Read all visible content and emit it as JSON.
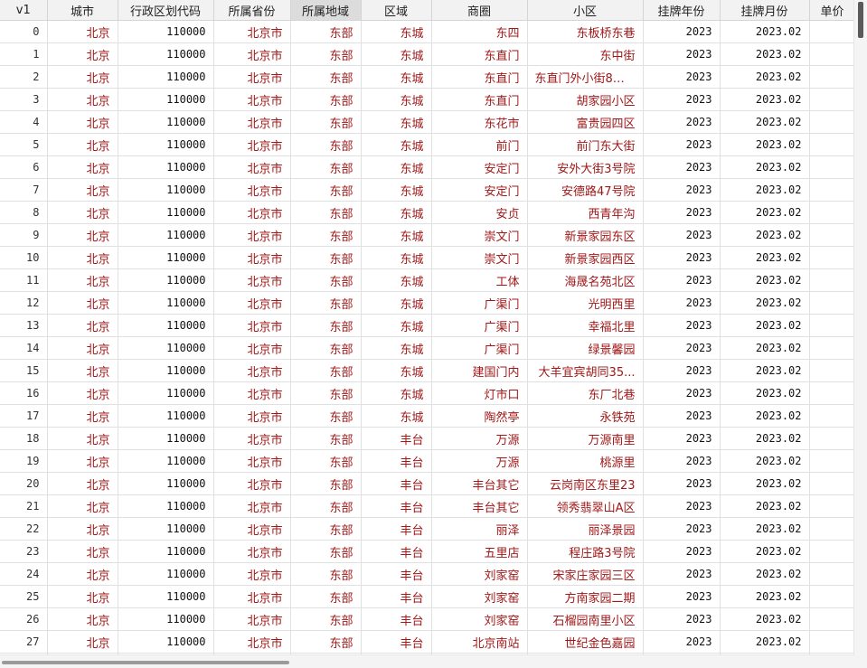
{
  "columns": [
    "v1",
    "城市",
    "行政区划代码",
    "所属省份",
    "所属地域",
    "区域",
    "商圈",
    "小区",
    "挂牌年份",
    "挂牌月份",
    "单价"
  ],
  "selected_column": "所属地域",
  "rows": [
    [
      "0",
      "北京",
      "110000",
      "北京市",
      "东部",
      "东城",
      "东四",
      "东板桥东巷",
      "2023",
      "2023.02",
      ""
    ],
    [
      "1",
      "北京",
      "110000",
      "北京市",
      "东部",
      "东城",
      "东直门",
      "东中街",
      "2023",
      "2023.02",
      ""
    ],
    [
      "2",
      "北京",
      "110000",
      "北京市",
      "东部",
      "东城",
      "东直门",
      "东直门外小街8号...",
      "2023",
      "2023.02",
      ""
    ],
    [
      "3",
      "北京",
      "110000",
      "北京市",
      "东部",
      "东城",
      "东直门",
      "胡家园小区",
      "2023",
      "2023.02",
      ""
    ],
    [
      "4",
      "北京",
      "110000",
      "北京市",
      "东部",
      "东城",
      "东花市",
      "富贵园四区",
      "2023",
      "2023.02",
      ""
    ],
    [
      "5",
      "北京",
      "110000",
      "北京市",
      "东部",
      "东城",
      "前门",
      "前门东大街",
      "2023",
      "2023.02",
      ""
    ],
    [
      "6",
      "北京",
      "110000",
      "北京市",
      "东部",
      "东城",
      "安定门",
      "安外大街3号院",
      "2023",
      "2023.02",
      ""
    ],
    [
      "7",
      "北京",
      "110000",
      "北京市",
      "东部",
      "东城",
      "安定门",
      "安德路47号院",
      "2023",
      "2023.02",
      ""
    ],
    [
      "8",
      "北京",
      "110000",
      "北京市",
      "东部",
      "东城",
      "安贞",
      "西青年沟",
      "2023",
      "2023.02",
      ""
    ],
    [
      "9",
      "北京",
      "110000",
      "北京市",
      "东部",
      "东城",
      "崇文门",
      "新景家园东区",
      "2023",
      "2023.02",
      ""
    ],
    [
      "10",
      "北京",
      "110000",
      "北京市",
      "东部",
      "东城",
      "崇文门",
      "新景家园西区",
      "2023",
      "2023.02",
      ""
    ],
    [
      "11",
      "北京",
      "110000",
      "北京市",
      "东部",
      "东城",
      "工体",
      "海晟名苑北区",
      "2023",
      "2023.02",
      ""
    ],
    [
      "12",
      "北京",
      "110000",
      "北京市",
      "东部",
      "东城",
      "广渠门",
      "光明西里",
      "2023",
      "2023.02",
      ""
    ],
    [
      "13",
      "北京",
      "110000",
      "北京市",
      "东部",
      "东城",
      "广渠门",
      "幸福北里",
      "2023",
      "2023.02",
      ""
    ],
    [
      "14",
      "北京",
      "110000",
      "北京市",
      "东部",
      "东城",
      "广渠门",
      "绿景馨园",
      "2023",
      "2023.02",
      ""
    ],
    [
      "15",
      "北京",
      "110000",
      "北京市",
      "东部",
      "东城",
      "建国门内",
      "大羊宜宾胡同35...",
      "2023",
      "2023.02",
      ""
    ],
    [
      "16",
      "北京",
      "110000",
      "北京市",
      "东部",
      "东城",
      "灯市口",
      "东厂北巷",
      "2023",
      "2023.02",
      ""
    ],
    [
      "17",
      "北京",
      "110000",
      "北京市",
      "东部",
      "东城",
      "陶然亭",
      "永铁苑",
      "2023",
      "2023.02",
      ""
    ],
    [
      "18",
      "北京",
      "110000",
      "北京市",
      "东部",
      "丰台",
      "万源",
      "万源南里",
      "2023",
      "2023.02",
      ""
    ],
    [
      "19",
      "北京",
      "110000",
      "北京市",
      "东部",
      "丰台",
      "万源",
      "桃源里",
      "2023",
      "2023.02",
      ""
    ],
    [
      "20",
      "北京",
      "110000",
      "北京市",
      "东部",
      "丰台",
      "丰台其它",
      "云岗南区东里23",
      "2023",
      "2023.02",
      ""
    ],
    [
      "21",
      "北京",
      "110000",
      "北京市",
      "东部",
      "丰台",
      "丰台其它",
      "领秀翡翠山A区",
      "2023",
      "2023.02",
      ""
    ],
    [
      "22",
      "北京",
      "110000",
      "北京市",
      "东部",
      "丰台",
      "丽泽",
      "丽泽景园",
      "2023",
      "2023.02",
      ""
    ],
    [
      "23",
      "北京",
      "110000",
      "北京市",
      "东部",
      "丰台",
      "五里店",
      "程庄路3号院",
      "2023",
      "2023.02",
      ""
    ],
    [
      "24",
      "北京",
      "110000",
      "北京市",
      "东部",
      "丰台",
      "刘家窑",
      "宋家庄家园三区",
      "2023",
      "2023.02",
      ""
    ],
    [
      "25",
      "北京",
      "110000",
      "北京市",
      "东部",
      "丰台",
      "刘家窑",
      "方南家园二期",
      "2023",
      "2023.02",
      ""
    ],
    [
      "26",
      "北京",
      "110000",
      "北京市",
      "东部",
      "丰台",
      "刘家窑",
      "石榴园南里小区",
      "2023",
      "2023.02",
      ""
    ],
    [
      "27",
      "北京",
      "110000",
      "北京市",
      "东部",
      "丰台",
      "北京南站",
      "世纪金色嘉园",
      "2023",
      "2023.02",
      ""
    ],
    [
      "",
      "",
      "",
      "",
      "",
      "",
      "",
      "",
      "",
      "",
      ""
    ]
  ]
}
